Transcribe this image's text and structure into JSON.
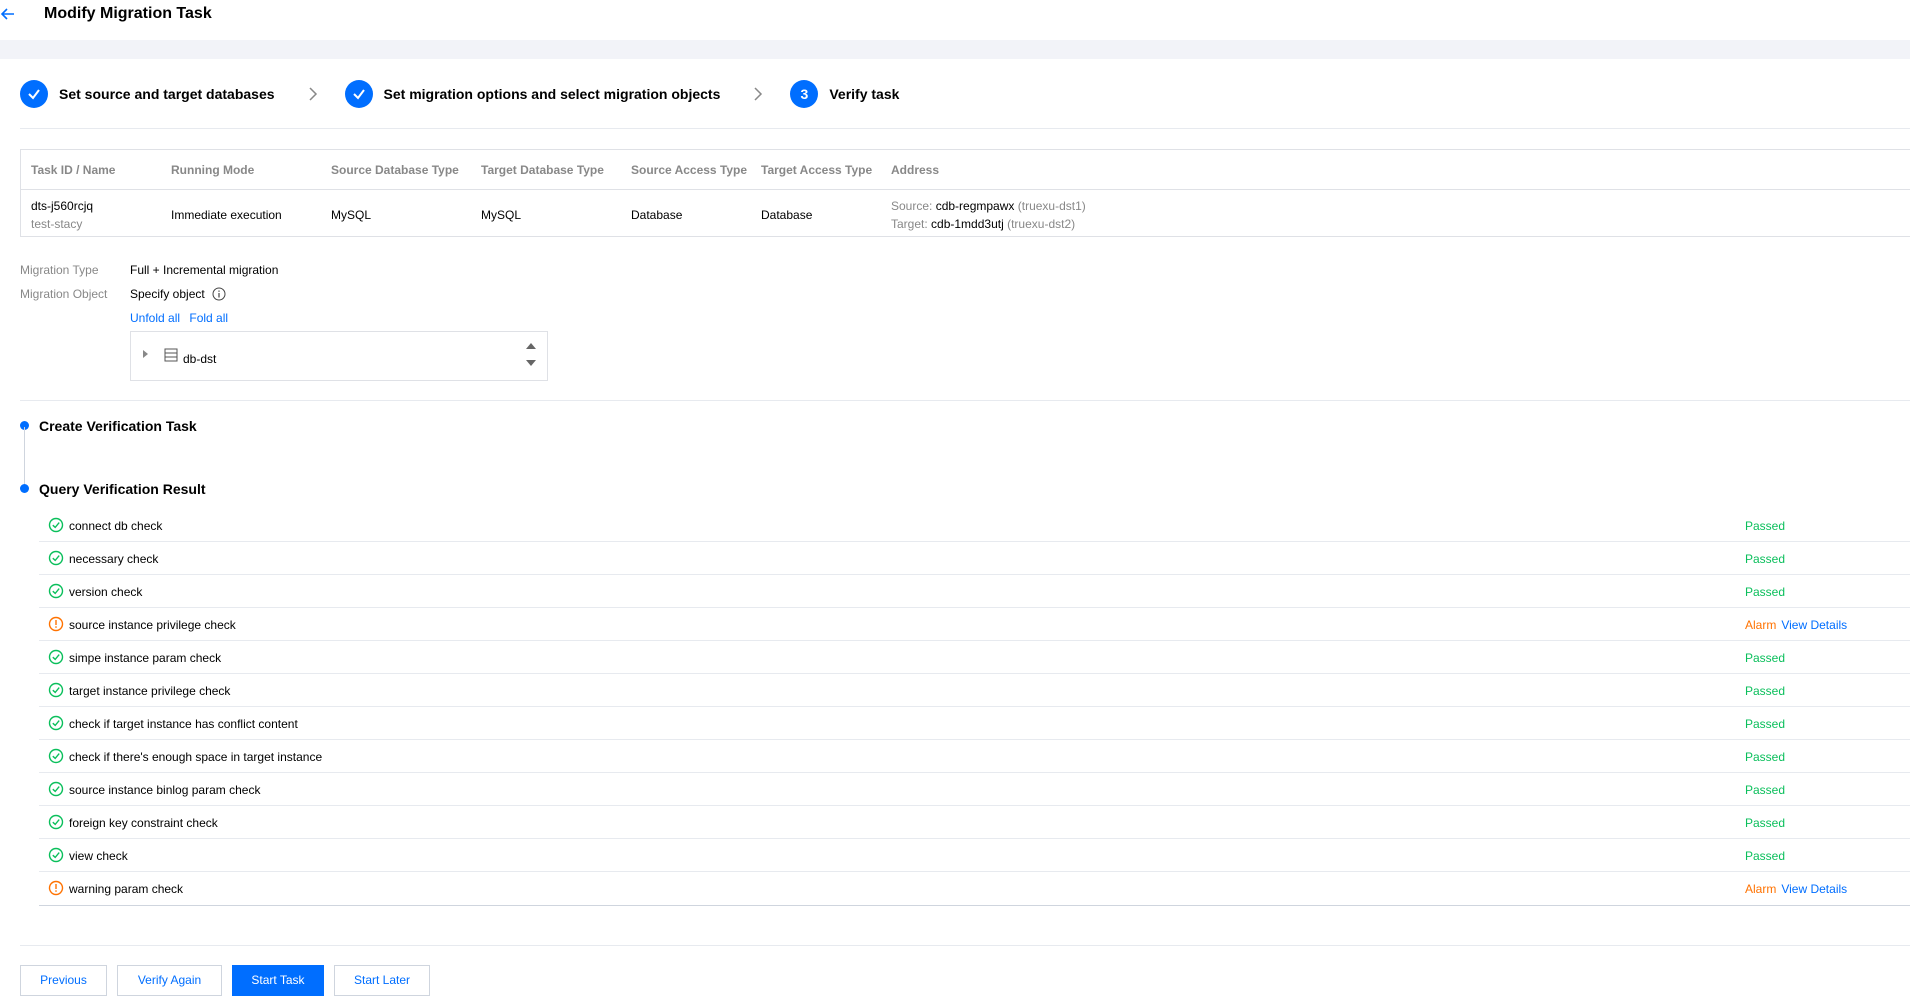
{
  "header": {
    "title": "Modify Migration Task"
  },
  "steps": [
    {
      "label": "Set source and target databases",
      "state": "done"
    },
    {
      "label": "Set migration options and select migration objects",
      "state": "done"
    },
    {
      "label": "Verify task",
      "number": "3",
      "state": "active"
    }
  ],
  "task_table": {
    "columns": [
      "Task ID / Name",
      "Running Mode",
      "Source Database Type",
      "Target Database Type",
      "Source Access Type",
      "Target Access Type",
      "Address"
    ],
    "row": {
      "task_id": "dts-j560rcjq",
      "task_name": "test-stacy",
      "running_mode": "Immediate execution",
      "source_db_type": "MySQL",
      "target_db_type": "MySQL",
      "source_access_type": "Database",
      "target_access_type": "Database",
      "source_label": "Source:",
      "source_instance": "cdb-regmpawx",
      "source_alias": "(truexu-dst1)",
      "target_label": "Target:",
      "target_instance": "cdb-1mdd3utj",
      "target_alias": "(truexu-dst2)"
    }
  },
  "migration": {
    "type_label": "Migration Type",
    "type_value": "Full + Incremental migration",
    "object_label": "Migration Object",
    "object_value": "Specify object",
    "unfold_all": "Unfold all",
    "fold_all": "Fold all",
    "tree": [
      {
        "label": "db-dst",
        "icon": "database-icon"
      }
    ]
  },
  "verification": {
    "create_title": "Create Verification Task",
    "query_title": "Query Verification Result",
    "view_details_label": "View Details",
    "checks": [
      {
        "name": "connect db check",
        "status": "Passed"
      },
      {
        "name": "necessary check",
        "status": "Passed"
      },
      {
        "name": "version check",
        "status": "Passed"
      },
      {
        "name": "source instance privilege check",
        "status": "Alarm"
      },
      {
        "name": "simpe instance param check",
        "status": "Passed"
      },
      {
        "name": "target instance privilege check",
        "status": "Passed"
      },
      {
        "name": "check if target instance has conflict content",
        "status": "Passed"
      },
      {
        "name": "check if there's enough space in target instance",
        "status": "Passed"
      },
      {
        "name": "source instance binlog param check",
        "status": "Passed"
      },
      {
        "name": "foreign key constraint check",
        "status": "Passed"
      },
      {
        "name": "view check",
        "status": "Passed"
      },
      {
        "name": "warning param check",
        "status": "Alarm"
      }
    ]
  },
  "footer": {
    "previous": "Previous",
    "verify_again": "Verify Again",
    "start_task": "Start Task",
    "start_later": "Start Later"
  },
  "colors": {
    "accent": "#006eff",
    "passed": "#0abf5b",
    "alarm": "#ff7200",
    "muted_text": "#888888"
  }
}
